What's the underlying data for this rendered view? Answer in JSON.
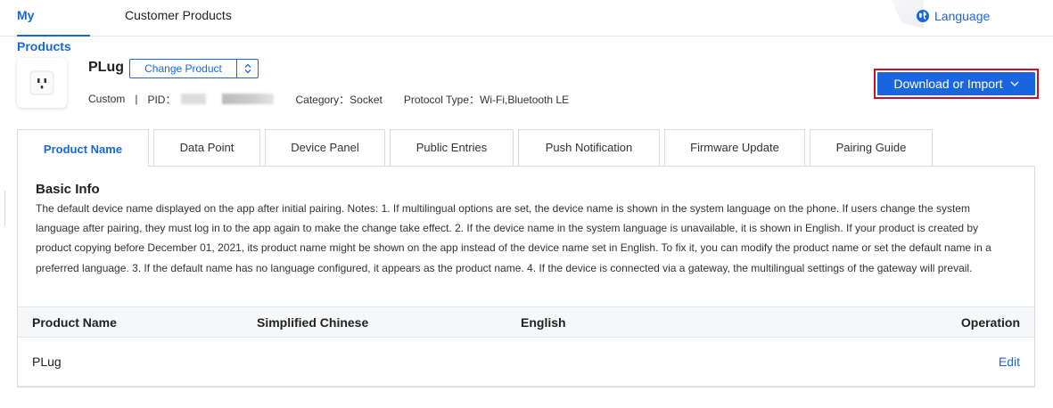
{
  "nav": {
    "tabs": [
      {
        "label": "My Products",
        "active": true
      },
      {
        "label": "Customer Products",
        "active": false
      }
    ],
    "language_label": "Language"
  },
  "product": {
    "name": "PLug",
    "change_button_label": "Change Product",
    "custom_label": "Custom",
    "separator": "|",
    "pid_label": "PID：",
    "category_label": "Category：Socket",
    "protocol_label": "Protocol Type：Wi-Fi,Bluetooth LE",
    "icon": "socket-icon"
  },
  "download_button_label": "Download or Import",
  "tabs": [
    {
      "label": "Product Name",
      "active": true
    },
    {
      "label": "Data Point",
      "active": false
    },
    {
      "label": "Device Panel",
      "active": false
    },
    {
      "label": "Public Entries",
      "active": false
    },
    {
      "label": "Push Notification",
      "active": false
    },
    {
      "label": "Firmware Update",
      "active": false
    },
    {
      "label": "Pairing Guide",
      "active": false
    }
  ],
  "basic_info": {
    "title": "Basic Info",
    "description": "The default device name displayed on the app after initial pairing. Notes: 1. If multilingual options are set, the device name is shown in the system language on the phone. If users change the system language after pairing, they must log in to the app again to make the change take effect. 2. If the device name in the system language is unavailable, it is shown in English. If your product is created by product copying before December 01, 2021, its product name might be shown on the app instead of the device name set in English. To fix it, you can modify the product name or set the default name in a preferred language. 3. If the default name has no language configured, it appears as the product name. 4. If the device is connected via a gateway, the multilingual settings of the gateway will prevail."
  },
  "table": {
    "headers": [
      "Product Name",
      "Simplified Chinese",
      "English",
      "Operation"
    ],
    "rows": [
      {
        "product_name": "PLug",
        "simplified_chinese": "",
        "english": "",
        "operation": "Edit"
      }
    ]
  },
  "colors": {
    "accent": "#1a66e0",
    "highlight_border": "#c8102e"
  }
}
